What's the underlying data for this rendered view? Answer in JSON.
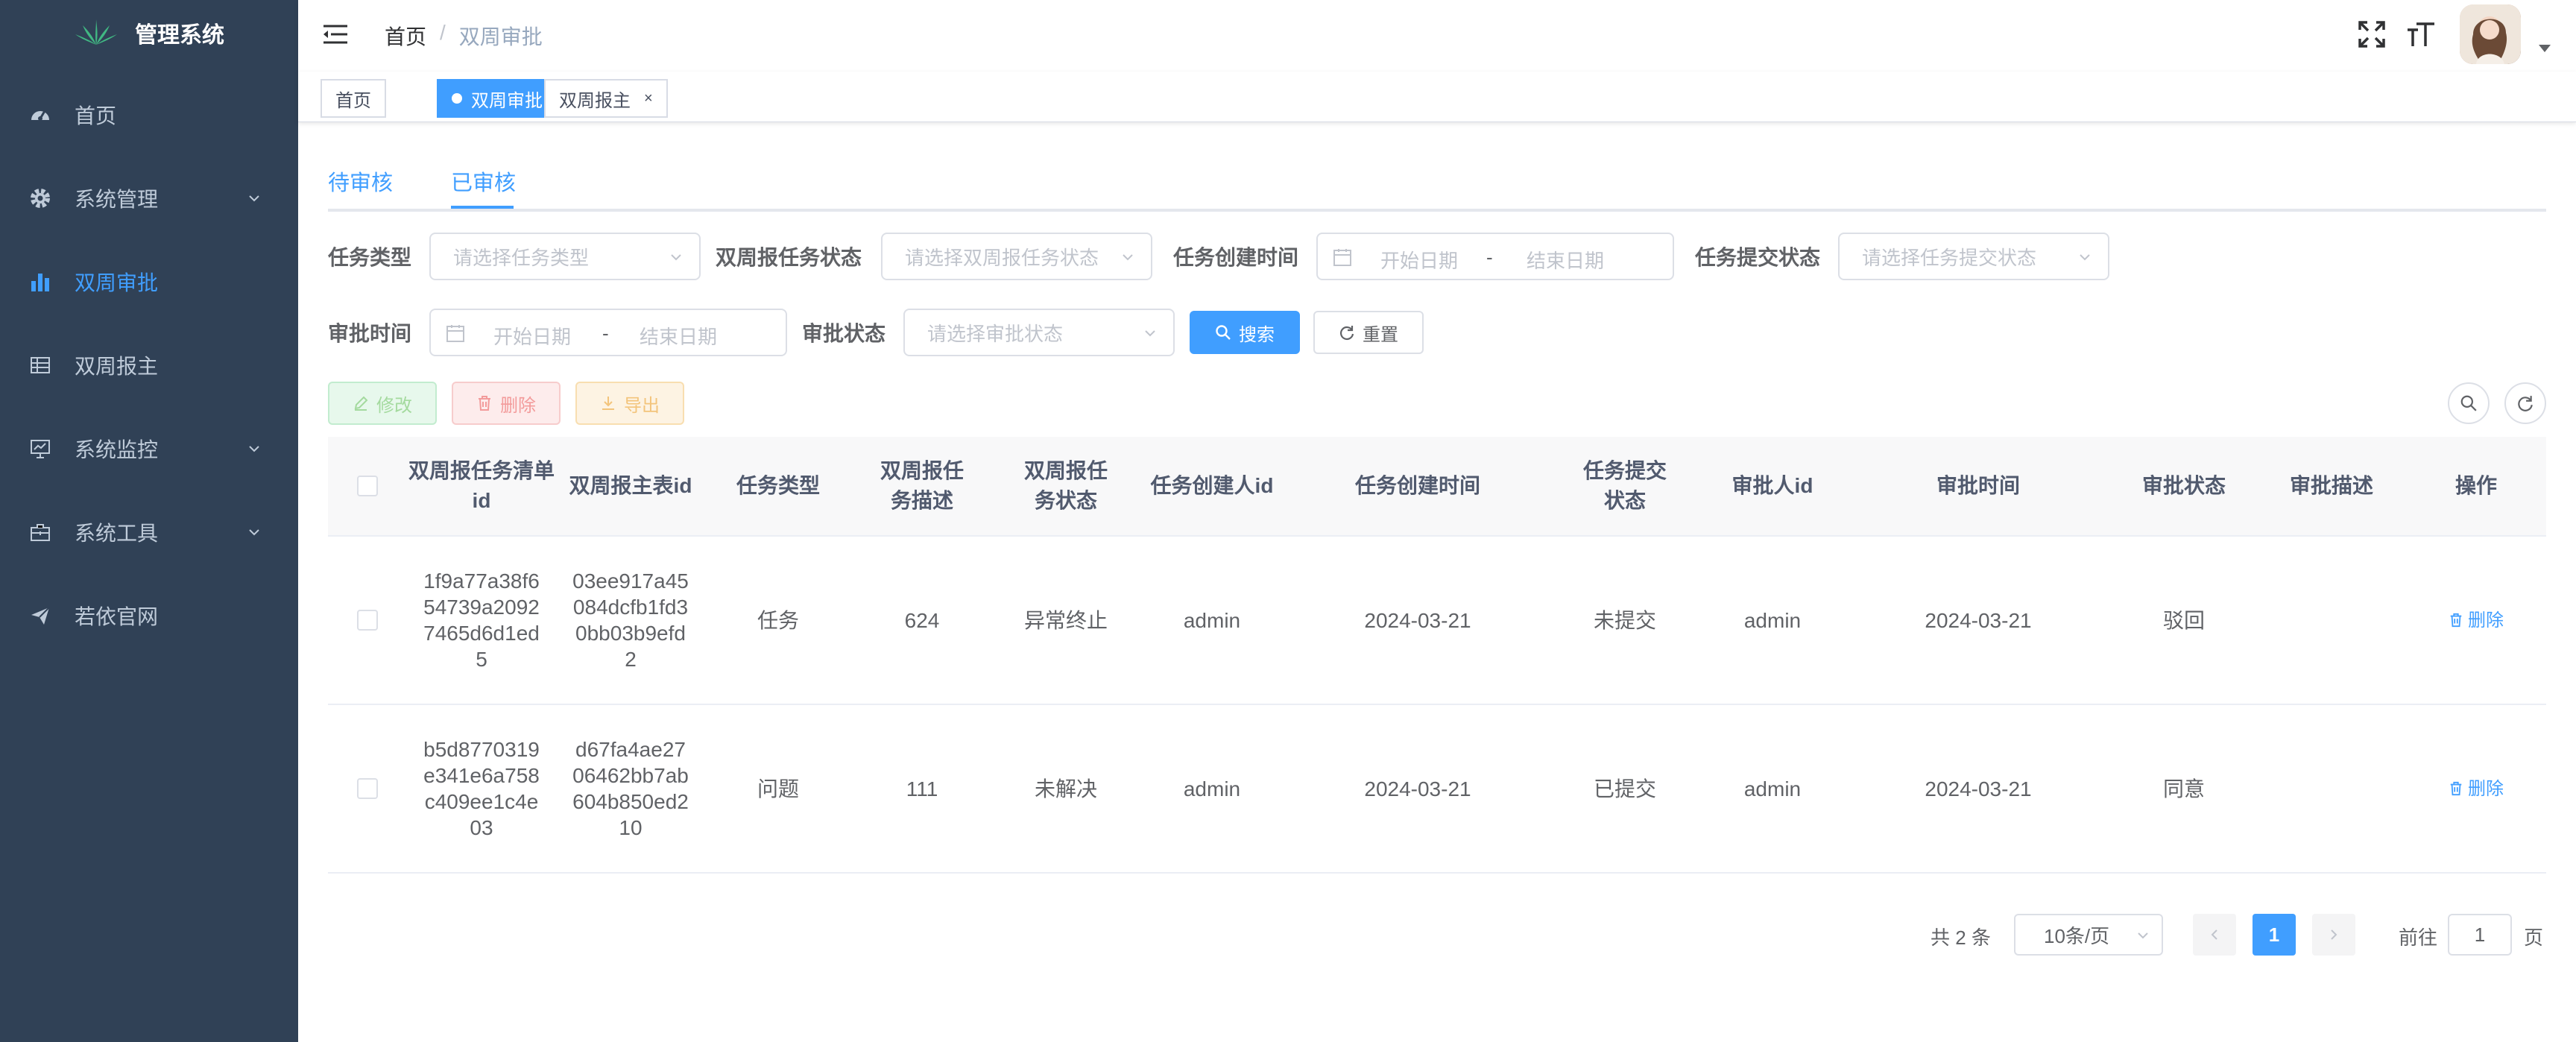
{
  "app": {
    "title": "管理系统"
  },
  "sidebar": {
    "items": [
      {
        "label": "首页",
        "icon": "dashboard-icon"
      },
      {
        "label": "系统管理",
        "icon": "gear-icon"
      },
      {
        "label": "双周审批",
        "icon": "bar-chart-icon",
        "active": true
      },
      {
        "label": "双周报主",
        "icon": "table-icon"
      },
      {
        "label": "系统监控",
        "icon": "monitor-icon"
      },
      {
        "label": "系统工具",
        "icon": "toolbox-icon"
      },
      {
        "label": "若依官网",
        "icon": "send-icon"
      }
    ]
  },
  "breadcrumb": {
    "home": "首页",
    "separator": "/",
    "current": "双周审批"
  },
  "tags": [
    {
      "label": "首页"
    },
    {
      "label": "双周审批",
      "close": "×"
    },
    {
      "label": "双周报主",
      "close": "×"
    }
  ],
  "tabs": [
    {
      "label": "待审核"
    },
    {
      "label": "已审核"
    }
  ],
  "filters": {
    "task_type": {
      "label": "任务类型",
      "placeholder": "请选择任务类型"
    },
    "biweekly_status": {
      "label": "双周报任务状态",
      "placeholder": "请选择双周报任务状态"
    },
    "create_time": {
      "label": "任务创建时间",
      "start": "开始日期",
      "sep": "-",
      "end": "结束日期"
    },
    "submit_status": {
      "label": "任务提交状态",
      "placeholder": "请选择任务提交状态"
    },
    "approve_time": {
      "label": "审批时间",
      "start": "开始日期",
      "sep": "-",
      "end": "结束日期"
    },
    "approve_status": {
      "label": "审批状态",
      "placeholder": "请选择审批状态"
    },
    "search": "搜索",
    "reset": "重置"
  },
  "toolbar": {
    "edit": "修改",
    "delete": "删除",
    "export": "导出"
  },
  "table": {
    "columns": [
      "双周报任务清单id",
      "双周报主表id",
      "任务类型",
      "双周报任务描述",
      "双周报任务状态",
      "任务创建人id",
      "任务创建时间",
      "任务提交状态",
      "审批人id",
      "审批时间",
      "审批状态",
      "审批描述",
      "操作"
    ],
    "rows": [
      {
        "c0": "1f9a77a38f654739a20927465d6d1ed5",
        "c1": "03ee917a45084dcfb1fd30bb03b9efd2",
        "c2": "任务",
        "c3": "624",
        "c4": "异常终止",
        "c5": "admin",
        "c6": "2024-03-21",
        "c7": "未提交",
        "c8": "admin",
        "c9": "2024-03-21",
        "c10": "驳回",
        "c11": "",
        "action": "删除"
      },
      {
        "c0": "b5d8770319e341e6a758c409ee1c4e03",
        "c1": "d67fa4ae2706462bb7ab604b850ed210",
        "c2": "问题",
        "c3": "111",
        "c4": "未解决",
        "c5": "admin",
        "c6": "2024-03-21",
        "c7": "已提交",
        "c8": "admin",
        "c9": "2024-03-21",
        "c10": "同意",
        "c11": "",
        "action": "删除"
      }
    ]
  },
  "pagination": {
    "total": "共 2 条",
    "page_size": "10条/页",
    "current": "1",
    "goto_prefix": "前往",
    "goto_value": "1",
    "goto_suffix": "页"
  },
  "colors": {
    "sidebar": "#304156",
    "primary": "#409eff",
    "active_text": "#409eff"
  }
}
